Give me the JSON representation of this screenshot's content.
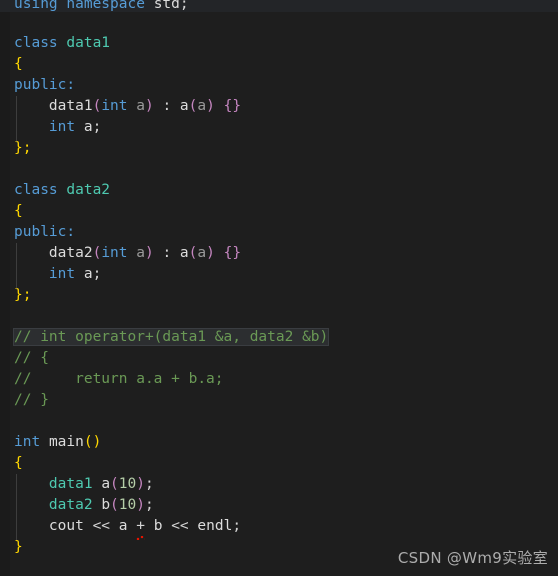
{
  "editor": {
    "language": "C++",
    "theme": "Dark+ (dark)",
    "background_color": "#1e1e1e",
    "current_line_color": "#232528",
    "selection_color": "#2c2e30",
    "error_squiggle_color": "#e51400"
  },
  "colors": {
    "keyword": "#569cd6",
    "type": "#4ec9b0",
    "identifier": "#dcdcdc",
    "parameter": "#9a9a9a",
    "bracket_magenta": "#c586c0",
    "bracket_yellow": "#ffd700",
    "number": "#b5cea8",
    "comment": "#6a9955",
    "punctuation": "#d4d4d4"
  },
  "code": {
    "line01": {
      "kw_using": "using",
      "kw_namespace": "namespace",
      "std": "std",
      "semi": ";"
    },
    "line03": {
      "kw": "class",
      "name": "data1"
    },
    "line04": {
      "brace": "{"
    },
    "line05": {
      "kw": "public",
      "colon": ":"
    },
    "line06": {
      "ctor": "data1",
      "lparen": "(",
      "kw_int": "int",
      "param": "a",
      "rparen": ")",
      "colon": " : ",
      "init": "a",
      "ilparen": "(",
      "iarg": "a",
      "irparen": ")",
      "body": "{}"
    },
    "line07": {
      "kw_int": "int",
      "member": "a",
      "semi": ";"
    },
    "line08": {
      "close": "};"
    },
    "line10": {
      "kw": "class",
      "name": "data2"
    },
    "line11": {
      "brace": "{"
    },
    "line12": {
      "kw": "public",
      "colon": ":"
    },
    "line13": {
      "ctor": "data2",
      "lparen": "(",
      "kw_int": "int",
      "param": "a",
      "rparen": ")",
      "colon": " : ",
      "init": "a",
      "ilparen": "(",
      "iarg": "a",
      "irparen": ")",
      "body": "{}"
    },
    "line14": {
      "kw_int": "int",
      "member": "a",
      "semi": ";"
    },
    "line15": {
      "close": "};"
    },
    "line17": {
      "comment": "// int operator+(data1 &a, data2 &b)"
    },
    "line18": {
      "comment": "// {"
    },
    "line19": {
      "comment": "//     return a.a + b.a;"
    },
    "line20": {
      "comment": "// }"
    },
    "line22": {
      "kw_int": "int",
      "name": "main",
      "parens": "()"
    },
    "line23": {
      "brace": "{"
    },
    "line24": {
      "type": "data1",
      "var": "a",
      "lparen": "(",
      "num": "10",
      "rparen": ")",
      "semi": ";"
    },
    "line25": {
      "type": "data2",
      "var": "b",
      "lparen": "(",
      "num": "10",
      "rparen": ")",
      "semi": ";"
    },
    "line26": {
      "cout": "cout",
      "op1": "<<",
      "a": "a",
      "plus": "+",
      "b": "b",
      "op2": "<<",
      "endl": "endl",
      "semi": ";"
    },
    "line27": {
      "brace": "}"
    }
  },
  "diagnostics": {
    "error_token": "+",
    "error_line": "cout << a + b << endl;"
  },
  "watermark": {
    "text": "CSDN @Wm9实验室"
  }
}
